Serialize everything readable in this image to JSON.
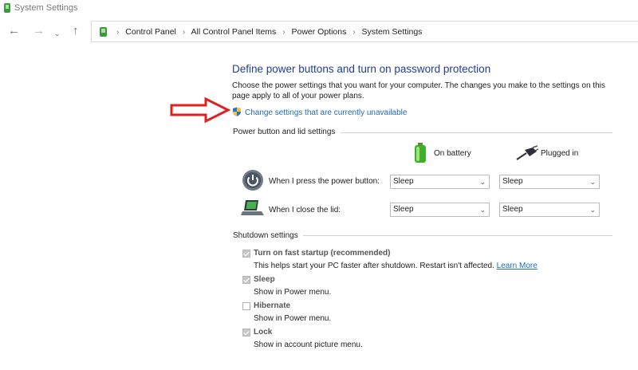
{
  "window": {
    "title": "System Settings"
  },
  "nav": {
    "back_icon": "back-arrow-icon",
    "forward_icon": "forward-arrow-icon",
    "recent_icon": "chevron-down-icon",
    "up_icon": "up-arrow-icon"
  },
  "breadcrumb": {
    "separator": "›",
    "items": [
      "Control Panel",
      "All Control Panel Items",
      "Power Options",
      "System Settings"
    ]
  },
  "page": {
    "heading": "Define power buttons and turn on password protection",
    "description": "Choose the power settings that you want for your computer. The changes you make to the settings on this page apply to all of your power plans.",
    "change_link": "Change settings that are currently unavailable"
  },
  "power_section": {
    "title": "Power button and lid settings",
    "col_battery": "On battery",
    "col_plugged": "Plugged in",
    "rows": [
      {
        "label": "When I press the power button:",
        "battery": "Sleep",
        "plugged": "Sleep"
      },
      {
        "label": "When I close the lid:",
        "battery": "Sleep",
        "plugged": "Sleep"
      }
    ]
  },
  "shutdown_section": {
    "title": "Shutdown settings",
    "items": [
      {
        "label": "Turn on fast startup (recommended)",
        "desc": "This helps start your PC faster after shutdown. Restart isn't affected.",
        "link": "Learn More",
        "checked": true
      },
      {
        "label": "Sleep",
        "desc": "Show in Power menu.",
        "checked": true
      },
      {
        "label": "Hibernate",
        "desc": "Show in Power menu.",
        "checked": false
      },
      {
        "label": "Lock",
        "desc": "Show in account picture menu.",
        "checked": true
      }
    ]
  },
  "colors": {
    "heading": "#1f3f95",
    "link": "#1d6ab8",
    "annotation_arrow": "#e02020"
  }
}
